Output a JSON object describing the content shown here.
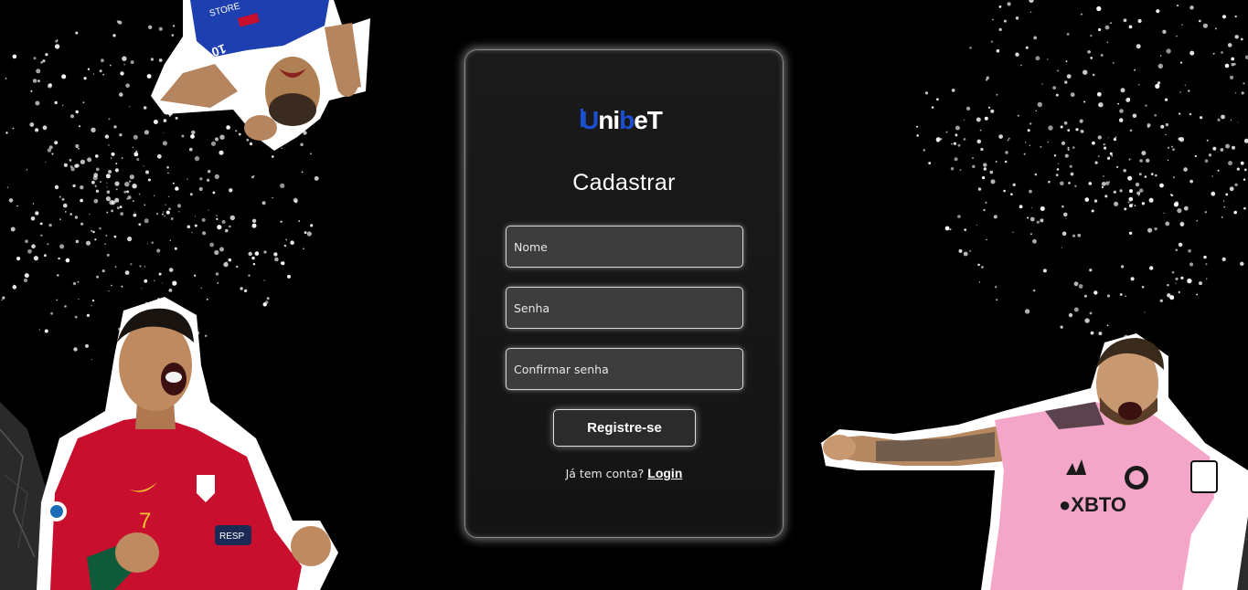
{
  "brand": {
    "logo_text": "Unibet",
    "accent_color": "#1a4fd0",
    "logo_color": "#ffffff"
  },
  "page": {
    "title": "Cadastrar"
  },
  "form": {
    "name_placeholder": "Nome",
    "password_placeholder": "Senha",
    "confirm_placeholder": "Confirmar senha",
    "submit_label": "Registre-se"
  },
  "footer": {
    "prompt": "Já tem conta?",
    "login_label": "Login"
  },
  "colors": {
    "background": "#000000",
    "card": "#161616",
    "field": "#3d3d3d",
    "portugal_red": "#c8102e",
    "inter_miami_pink": "#f4a6c8",
    "blue_kit": "#1e3fb0"
  },
  "decor": {
    "top_left": "player-blue-kit",
    "bottom_left": "player-red-kit",
    "bottom_right": "player-pink-kit"
  }
}
